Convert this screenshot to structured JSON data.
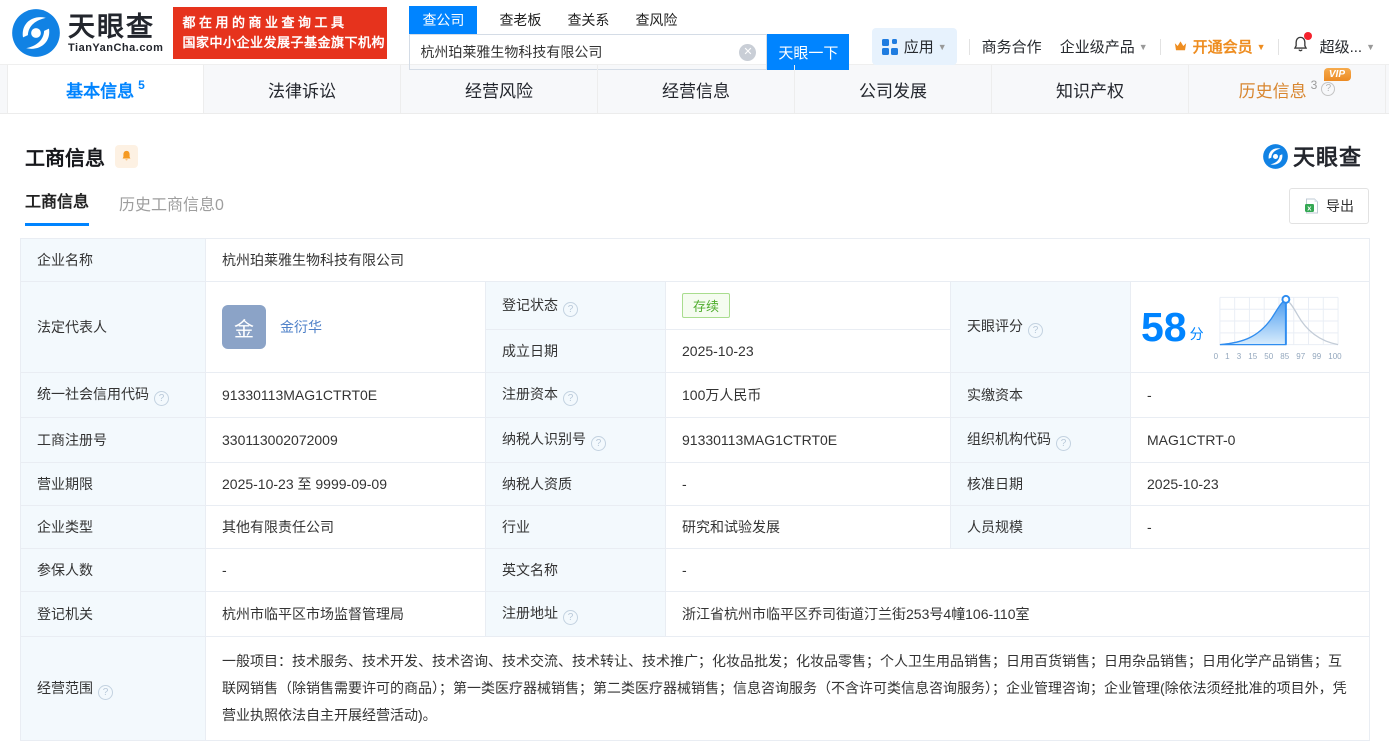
{
  "brand": {
    "name": "天眼查",
    "domain": "TianYanCha.com",
    "promo_line1": "都在用的商业查询工具",
    "promo_line2": "国家中小企业发展子基金旗下机构"
  },
  "search": {
    "tabs": [
      "查公司",
      "查老板",
      "查关系",
      "查风险"
    ],
    "active_tab": "查公司",
    "value": "杭州珀莱雅生物科技有限公司",
    "button": "天眼一下"
  },
  "topnav": {
    "apps": "应用",
    "cooperation": "商务合作",
    "enterprise": "企业级产品",
    "vip": "开通会员",
    "more": "超级..."
  },
  "tabs": {
    "items": [
      {
        "label": "基本信息",
        "count": "5"
      },
      {
        "label": "法律诉讼",
        "count": ""
      },
      {
        "label": "经营风险",
        "count": ""
      },
      {
        "label": "经营信息",
        "count": ""
      },
      {
        "label": "公司发展",
        "count": ""
      },
      {
        "label": "知识产权",
        "count": ""
      },
      {
        "label": "历史信息",
        "count": "3",
        "vip": "VIP"
      }
    ]
  },
  "section": {
    "title": "工商信息",
    "watermark": "天眼查",
    "subtabs": [
      {
        "label": "工商信息"
      },
      {
        "label": "历史工商信息0"
      }
    ],
    "export_label": "导出"
  },
  "table": {
    "company_name": {
      "label": "企业名称",
      "value": "杭州珀莱雅生物科技有限公司"
    },
    "legal_rep": {
      "label": "法定代表人",
      "avatar": "金",
      "name": "金衍华"
    },
    "reg_status": {
      "label": "登记状态",
      "value": "存续"
    },
    "establish_date": {
      "label": "成立日期",
      "value": "2025-10-23"
    },
    "score": {
      "label": "天眼评分"
    },
    "credit_code": {
      "label": "统一社会信用代码",
      "value": "91330113MAG1CTRT0E"
    },
    "reg_capital": {
      "label": "注册资本",
      "value": "100万人民币"
    },
    "paid_capital": {
      "label": "实缴资本",
      "value": "-"
    },
    "reg_number": {
      "label": "工商注册号",
      "value": "330113002072009"
    },
    "taxpayer_id": {
      "label": "纳税人识别号",
      "value": "91330113MAG1CTRT0E"
    },
    "org_code": {
      "label": "组织机构代码",
      "value": "MAG1CTRT-0"
    },
    "business_term": {
      "label": "营业期限",
      "value": "2025-10-23 至 9999-09-09"
    },
    "taxpayer_quality": {
      "label": "纳税人资质",
      "value": "-"
    },
    "approval_date": {
      "label": "核准日期",
      "value": "2025-10-23"
    },
    "company_type": {
      "label": "企业类型",
      "value": "其他有限责任公司"
    },
    "industry": {
      "label": "行业",
      "value": "研究和试验发展"
    },
    "staff_size": {
      "label": "人员规模",
      "value": "-"
    },
    "insured_count": {
      "label": "参保人数",
      "value": "-"
    },
    "english_name": {
      "label": "英文名称",
      "value": "-"
    },
    "reg_authority": {
      "label": "登记机关",
      "value": "杭州市临平区市场监督管理局"
    },
    "reg_address": {
      "label": "注册地址",
      "value": "浙江省杭州市临平区乔司街道汀兰街253号4幢106-110室"
    },
    "business_scope": {
      "label": "经营范围",
      "value": "一般项目：技术服务、技术开发、技术咨询、技术交流、技术转让、技术推广；化妆品批发；化妆品零售；个人卫生用品销售；日用百货销售；日用杂品销售；日用化学产品销售；互联网销售（除销售需要许可的商品）；第一类医疗器械销售；第二类医疗器械销售；信息咨询服务（不含许可类信息咨询服务）；企业管理咨询；企业管理(除依法须经批准的项目外，凭营业执照依法自主开展经营活动)。"
    }
  },
  "score_chart": {
    "type": "area",
    "score": "58",
    "unit": "分",
    "ticks": [
      "0",
      "1",
      "3",
      "15",
      "50",
      "85",
      "97",
      "99",
      "100"
    ],
    "accent_color": "#0084ff"
  }
}
